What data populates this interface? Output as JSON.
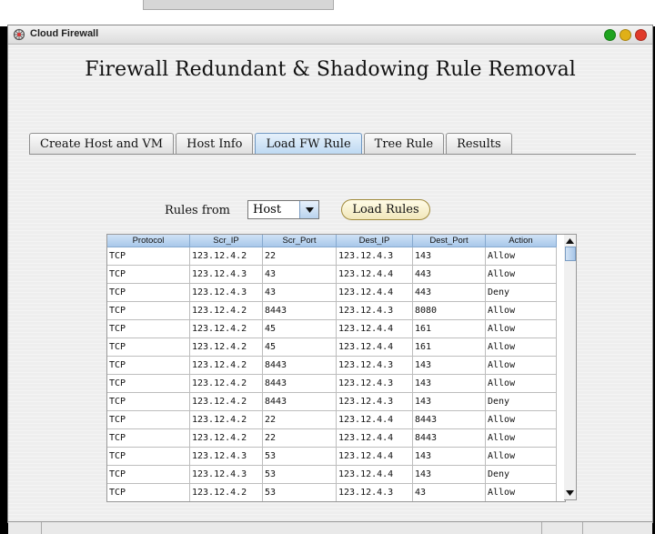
{
  "window": {
    "title": "Cloud Firewall",
    "buttons": [
      {
        "name": "minimize",
        "color": "#1fa31f"
      },
      {
        "name": "maximize",
        "color": "#e0b018"
      },
      {
        "name": "close",
        "color": "#e03a2a"
      }
    ]
  },
  "heading": "Firewall Redundant & Shadowing Rule Removal",
  "tabs": [
    {
      "label": "Create Host and VM",
      "active": false
    },
    {
      "label": "Host Info",
      "active": false
    },
    {
      "label": "Load FW Rule",
      "active": true
    },
    {
      "label": "Tree Rule",
      "active": false
    },
    {
      "label": "Results",
      "active": false
    }
  ],
  "controls": {
    "rules_from_label": "Rules from",
    "rules_from_value": "Host",
    "load_button": "Load Rules"
  },
  "table": {
    "columns": [
      "Protocol",
      "Scr_IP",
      "Scr_Port",
      "Dest_IP",
      "Dest_Port",
      "Action"
    ],
    "rows": [
      [
        "TCP",
        "123.12.4.2",
        "22",
        "123.12.4.3",
        "143",
        "Allow"
      ],
      [
        "TCP",
        "123.12.4.3",
        "43",
        "123.12.4.4",
        "443",
        "Allow"
      ],
      [
        "TCP",
        "123.12.4.3",
        "43",
        "123.12.4.4",
        "443",
        "Deny"
      ],
      [
        "TCP",
        "123.12.4.2",
        "8443",
        "123.12.4.3",
        "8080",
        "Allow"
      ],
      [
        "TCP",
        "123.12.4.2",
        "45",
        "123.12.4.4",
        "161",
        "Allow"
      ],
      [
        "TCP",
        "123.12.4.2",
        "45",
        "123.12.4.4",
        "161",
        "Allow"
      ],
      [
        "TCP",
        "123.12.4.2",
        "8443",
        "123.12.4.3",
        "143",
        "Allow"
      ],
      [
        "TCP",
        "123.12.4.2",
        "8443",
        "123.12.4.3",
        "143",
        "Allow"
      ],
      [
        "TCP",
        "123.12.4.2",
        "8443",
        "123.12.4.3",
        "143",
        "Deny"
      ],
      [
        "TCP",
        "123.12.4.2",
        "22",
        "123.12.4.4",
        "8443",
        "Allow"
      ],
      [
        "TCP",
        "123.12.4.2",
        "22",
        "123.12.4.4",
        "8443",
        "Allow"
      ],
      [
        "TCP",
        "123.12.4.3",
        "53",
        "123.12.4.4",
        "143",
        "Allow"
      ],
      [
        "TCP",
        "123.12.4.3",
        "53",
        "123.12.4.4",
        "143",
        "Deny"
      ],
      [
        "TCP",
        "123.12.4.2",
        "53",
        "123.12.4.3",
        "43",
        "Allow"
      ]
    ]
  }
}
